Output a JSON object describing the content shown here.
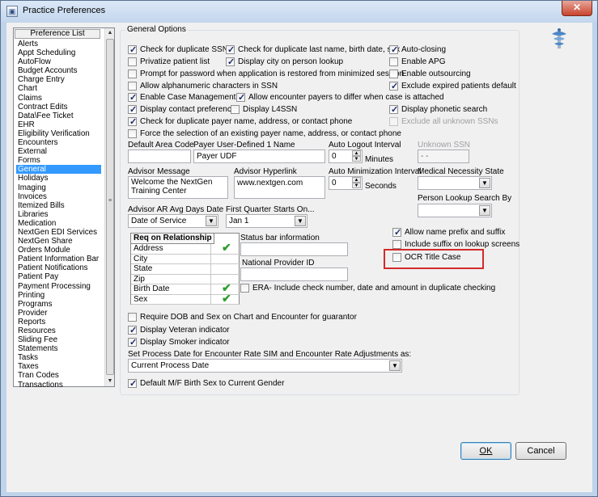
{
  "window": {
    "title": "Practice Preferences",
    "close_label": "✕",
    "app_icon": "app-icon"
  },
  "sidebar": {
    "header": "Preference List",
    "items": [
      "Alerts",
      "Appt Scheduling",
      "AutoFlow",
      "Budget Accounts",
      "Charge Entry",
      "Chart",
      "Claims",
      "Contract Edits",
      "Data\\Fee Ticket",
      "EHR",
      "Eligibility Verification",
      "Encounters",
      "External",
      "Forms",
      "General",
      "Holidays",
      "Imaging",
      "Invoices",
      "Itemized Bills",
      "Libraries",
      "Medication",
      "NextGen EDI Services",
      "NextGen Share",
      "Orders Module",
      "Patient Information Bar",
      "Patient Notifications",
      "Patient Pay",
      "Payment Processing",
      "Printing",
      "Programs",
      "Provider",
      "Reports",
      "Resources",
      "Sliding Fee",
      "Statements",
      "Tasks",
      "Taxes",
      "Tran Codes",
      "Transactions"
    ],
    "selected": "General"
  },
  "general": {
    "group_label": "General Options",
    "cb": {
      "dup_ssn": "Check for duplicate SSN",
      "privatize": "Privatize patient list",
      "prompt_pwd": "Prompt for password when application is restored from minimized session",
      "alnum_ssn": "Allow alphanumeric characters in SSN",
      "case_mgmt": "Enable Case Management",
      "contact_pref": "Display contact preference",
      "dup_payer": "Check for duplicate payer name, address, or contact phone",
      "force_payer": "Force the selection of an existing payer name, address, or contact phone",
      "dup_last": "Check for duplicate last name, birth date, sex",
      "city_lookup": "Display city on person lookup",
      "enc_payers": "Allow encounter payers to differ when case is attached",
      "l4ssn": "Display L4SSN",
      "auto_closing": "Auto-closing",
      "enable_apg": "Enable APG",
      "enable_out": "Enable outsourcing",
      "exclude_expired": "Exclude expired patients default",
      "phonetic": "Display phonetic search",
      "exclude_ssn": "Exclude all unknown SSNs",
      "name_prefix": "Allow name prefix and suffix",
      "include_suffix": "Include suffix on lookup screens",
      "ocr_title": "OCR Title Case",
      "era": "ERA- Include check number, date and amount in duplicate checking",
      "require_dob": "Require DOB and Sex on Chart and Encounter for guarantor",
      "veteran": "Display Veteran indicator",
      "smoker": "Display Smoker indicator",
      "mf_birth": "Default M/F Birth Sex to Current Gender"
    },
    "fields": {
      "area_code_label": "Default Area Code",
      "area_code_value": "",
      "udf_label": "Payer User-Defined 1 Name",
      "udf_value": "Payer UDF",
      "logout_label": "Auto Logout Interval",
      "logout_value": "0",
      "logout_unit": "Minutes",
      "unknown_ssn_label": "Unknown SSN",
      "unknown_ssn_value": "- -",
      "advisor_msg_label": "Advisor Message",
      "advisor_msg_value": "Welcome the NextGen Training Center",
      "advisor_link_label": "Advisor Hyperlink",
      "advisor_link_value": "www.nextgen.com",
      "min_label": "Auto Minimization Interval",
      "min_value": "0",
      "min_unit": "Seconds",
      "med_nec_label": "Medical Necessity State",
      "med_nec_value": "",
      "person_lookup_label": "Person Lookup Search By",
      "person_lookup_value": "",
      "ar_days_label": "Advisor AR Avg Days Date",
      "ar_days_value": "Date of Service",
      "first_qtr_label": "First Quarter Starts On...",
      "first_qtr_value": "Jan 1",
      "status_bar_label": "Status bar information",
      "status_bar_value": "",
      "npi_label": "National Provider ID",
      "npi_value": "",
      "process_date_label": "Set Process Date for Encounter Rate SIM and Encounter Rate Adjustments as:",
      "process_date_value": "Current Process Date"
    },
    "req_table": {
      "header": "Req on Relationship",
      "rows": [
        "Address",
        "City",
        "State",
        "Zip",
        "Birth Date",
        "Sex"
      ],
      "checked": [
        true,
        false,
        false,
        false,
        true,
        true
      ]
    }
  },
  "buttons": {
    "ok": "OK",
    "cancel": "Cancel"
  }
}
